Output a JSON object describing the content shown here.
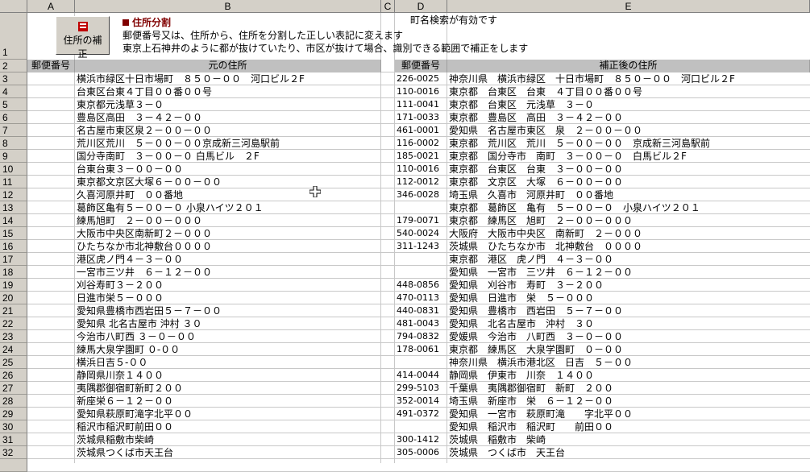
{
  "columns": [
    "A",
    "B",
    "C",
    "D",
    "E"
  ],
  "header": {
    "title": "住所分割",
    "desc1": "郵便番号又は、住所から、住所を分割した正しい表記に変えます",
    "desc2": "東京上石神井のように都が抜けていたり、市区が抜けて場合、識別できる範囲で補正をします",
    "status": "町名検索が有効です",
    "button_label": "住所の補正",
    "accent_color": "#800000"
  },
  "table_headers": {
    "postal_left": "郵便番号",
    "original_address": "元の住所",
    "postal_right": "郵便番号",
    "corrected_address": "補正後の住所"
  },
  "rows": [
    {
      "row": "3",
      "orig": "横浜市緑区十日市場町　８５０－００　河口ビル２F",
      "zip": "226-0025",
      "fixed": "神奈川県　横浜市緑区　十日市場町　８５０－００　河口ビル２F"
    },
    {
      "row": "4",
      "orig": "台東区台東４丁目００番００号",
      "zip": "110-0016",
      "fixed": "東京都　台東区　台東　４丁目００番００号"
    },
    {
      "row": "5",
      "orig": "東京都元浅草３－０",
      "zip": "111-0041",
      "fixed": "東京都　台東区　元浅草　３－０"
    },
    {
      "row": "6",
      "orig": "豊島区高田　３－４２－００",
      "zip": "171-0033",
      "fixed": "東京都　豊島区　高田　３－４２－００"
    },
    {
      "row": "7",
      "orig": "名古屋市東区泉２－００－００",
      "zip": "461-0001",
      "fixed": "愛知県　名古屋市東区　泉　２－００－００"
    },
    {
      "row": "8",
      "orig": "荒川区荒川　５－００－００京成新三河島駅前",
      "zip": "116-0002",
      "fixed": "東京都　荒川区　荒川　５－００－００　京成新三河島駅前"
    },
    {
      "row": "9",
      "orig": "国分寺南町　３－００－０ 白馬ビル　２F",
      "zip": "185-0021",
      "fixed": "東京都　国分寺市　南町　３－００－０　白馬ビル２F"
    },
    {
      "row": "10",
      "orig": "台東台東３－００－００",
      "zip": "110-0016",
      "fixed": "東京都　台東区　台東　３－００－００"
    },
    {
      "row": "11",
      "orig": "東京都文京区大塚６－００－００",
      "zip": "112-0012",
      "fixed": "東京都　文京区　大塚　６－００－００"
    },
    {
      "row": "12",
      "orig": "久喜河原井町　００番地",
      "zip": "346-0028",
      "fixed": "埼玉県　久喜市　河原井町　００番地"
    },
    {
      "row": "13",
      "orig": "葛飾区亀有５－００－０ 小泉ハイツ２０１",
      "zip": "",
      "fixed": "東京都　葛飾区　亀有　５－００－０　小泉ハイツ２０１"
    },
    {
      "row": "14",
      "orig": "練馬旭町　２－００－０００",
      "zip": "179-0071",
      "fixed": "東京都　練馬区　旭町　２－００－０００"
    },
    {
      "row": "15",
      "orig": "大阪市中央区南新町２－０００",
      "zip": "540-0024",
      "fixed": "大阪府　大阪市中央区　南新町　２－０００"
    },
    {
      "row": "16",
      "orig": "ひたちなか市北神敷台００００",
      "zip": "311-1243",
      "fixed": "茨城県　ひたちなか市　北神敷台　００００"
    },
    {
      "row": "17",
      "orig": "港区虎ノ門４－３－００",
      "zip": "",
      "fixed": "東京都　港区　虎ノ門　４－３－００"
    },
    {
      "row": "18",
      "orig": "一宮市三ツ井　６－１２－００",
      "zip": "",
      "fixed": "愛知県　一宮市　三ツ井　６－１２－００"
    },
    {
      "row": "19",
      "orig": "刈谷寿町３－２００",
      "zip": "448-0856",
      "fixed": "愛知県　刈谷市　寿町　３－２００"
    },
    {
      "row": "20",
      "orig": "日進市栄５－０００",
      "zip": "470-0113",
      "fixed": "愛知県　日進市　栄　５－０００"
    },
    {
      "row": "21",
      "orig": "愛知県豊橋市西岩田５－７－００",
      "zip": "440-0831",
      "fixed": "愛知県　豊橋市　西岩田　５－７－００"
    },
    {
      "row": "22",
      "orig": "愛知県 北名古屋市 沖村 ３０",
      "zip": "481-0043",
      "fixed": "愛知県　北名古屋市　沖村　３０"
    },
    {
      "row": "23",
      "orig": "今治市八町西 ３－０－００",
      "zip": "794-0832",
      "fixed": "愛媛県　今治市　八町西　３－０－００"
    },
    {
      "row": "24",
      "orig": "練馬大泉学園町 ０-００",
      "zip": "178-0061",
      "fixed": "東京都　練馬区　大泉学園町　０－００"
    },
    {
      "row": "25",
      "orig": "横浜日吉５-００",
      "zip": "",
      "fixed": "神奈川県　横浜市港北区　日吉　５－００"
    },
    {
      "row": "26",
      "orig": "静岡県川奈１４００",
      "zip": "414-0044",
      "fixed": "静岡県　伊東市　川奈　１４００"
    },
    {
      "row": "27",
      "orig": "夷隅郡御宿町新町２００",
      "zip": "299-5103",
      "fixed": "千葉県　夷隅郡御宿町　新町　２００"
    },
    {
      "row": "28",
      "orig": "新座栄６－１２－００",
      "zip": "352-0014",
      "fixed": "埼玉県　新座市　栄　６－１２－００"
    },
    {
      "row": "29",
      "orig": "愛知県萩原町滝字北平００",
      "zip": "491-0372",
      "fixed": "愛知県　一宮市　萩原町滝　　字北平００"
    },
    {
      "row": "30",
      "orig": "稲沢市稲沢町前田００",
      "zip": "",
      "fixed": "愛知県　稲沢市　稲沢町　　前田００"
    },
    {
      "row": "31",
      "orig": "茨城県稲敷市柴崎",
      "zip": "300-1412",
      "fixed": "茨城県　稲敷市　柴崎"
    },
    {
      "row": "32",
      "orig": "茨城県つくば市天王台",
      "zip": "305-0006",
      "fixed": "茨城県　つくば市　天王台"
    }
  ]
}
